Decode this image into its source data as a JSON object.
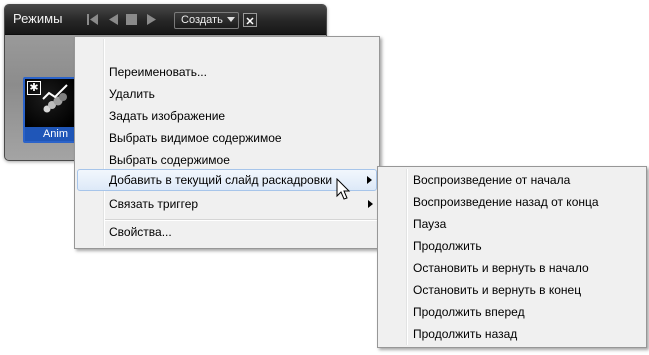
{
  "panel": {
    "title": "Режимы",
    "create_label": "Создать",
    "state_label": "Anim",
    "icons": [
      "go-to-start-icon",
      "step-back-icon",
      "stop-icon",
      "play-icon",
      "dropdown-arrow-icon",
      "close-icon",
      "star-icon"
    ]
  },
  "menu": {
    "items": [
      {
        "label": "Переименовать..."
      },
      {
        "label": "Удалить"
      },
      {
        "label": "Задать изображение"
      },
      {
        "label": "Выбрать видимое содержимое"
      },
      {
        "label": "Выбрать содержимое"
      },
      {
        "label": "Добавить в текущий слайд раскадровки",
        "highlighted": true,
        "submenu": true
      },
      {
        "label": "Связать триггер",
        "submenu": true
      },
      {
        "label": "Свойства..."
      }
    ]
  },
  "submenu": {
    "items": [
      {
        "label": "Воспроизведение от начала"
      },
      {
        "label": "Воспроизведение назад от конца"
      },
      {
        "label": "Пауза"
      },
      {
        "label": "Продолжить"
      },
      {
        "label": "Остановить и вернуть в начало"
      },
      {
        "label": "Остановить и вернуть в конец"
      },
      {
        "label": "Продолжить вперед"
      },
      {
        "label": "Продолжить назад"
      }
    ]
  },
  "colors": {
    "panel_header": "#262626",
    "selection_blue": "#2b63c9",
    "menu_background": "#f0f0f0",
    "hover_border": "#a7c5ea"
  }
}
